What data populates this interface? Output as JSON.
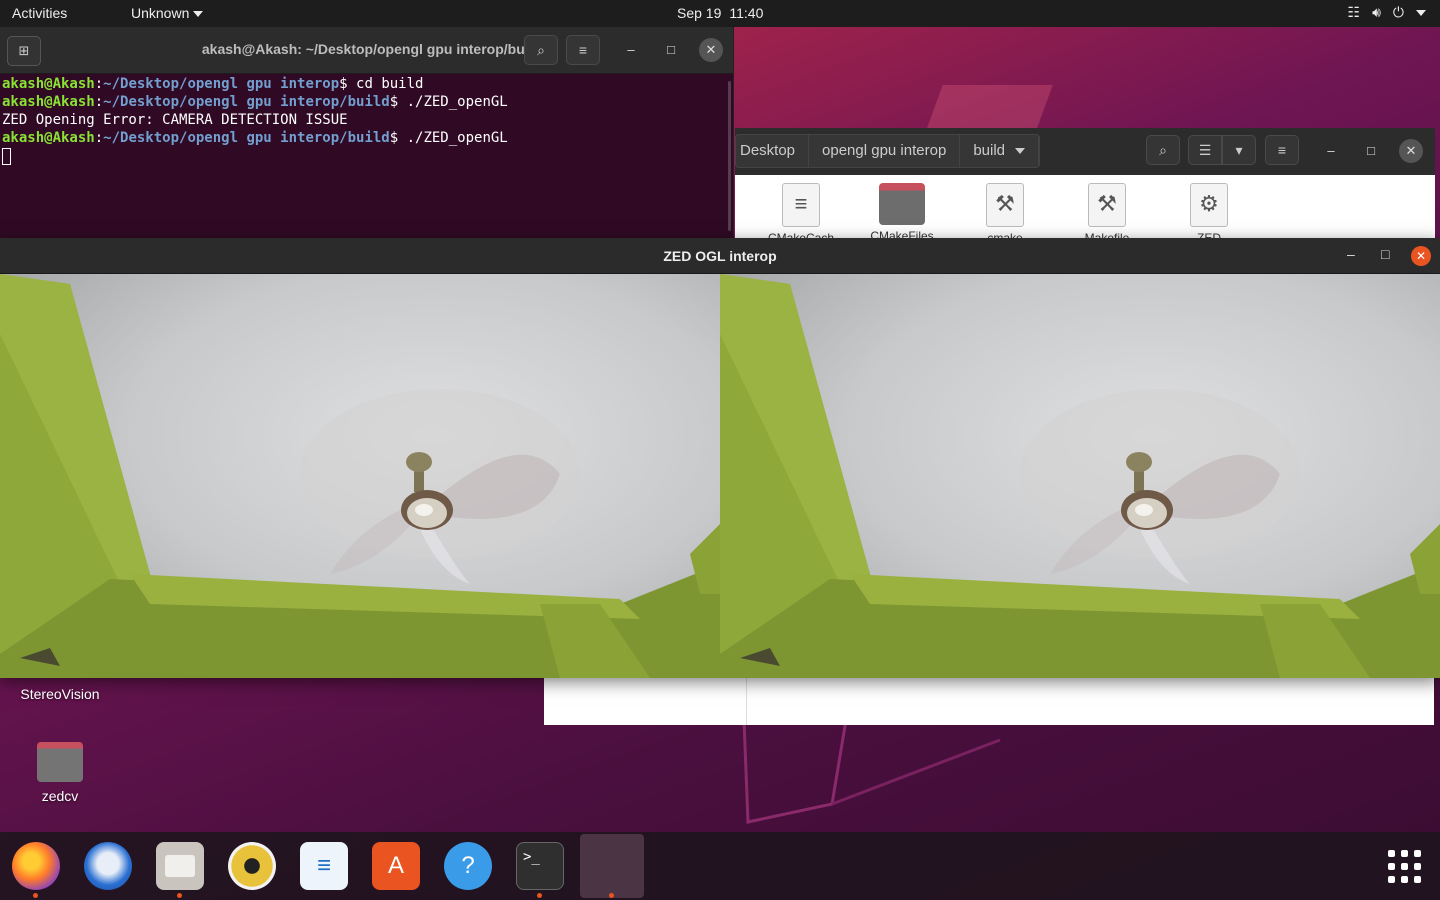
{
  "topbar": {
    "activities": "Activities",
    "app_menu": "Unknown",
    "date": "Sep 19",
    "time": "11:40"
  },
  "terminal": {
    "title": "akash@Akash: ~/Desktop/opengl gpu interop/build",
    "lines": [
      {
        "user": "akash@Akash",
        "path": "~/Desktop/opengl gpu interop",
        "cmd": "$ cd build"
      },
      {
        "user": "akash@Akash",
        "path": "~/Desktop/opengl gpu interop/build",
        "cmd": "$ ./ZED_openGL"
      },
      {
        "text": "ZED Opening Error: CAMERA DETECTION ISSUE"
      },
      {
        "user": "akash@Akash",
        "path": "~/Desktop/opengl gpu interop/build",
        "cmd": "$ ./ZED_openGL"
      }
    ]
  },
  "files": {
    "breadcrumbs": [
      "Desktop",
      "opengl gpu interop",
      "build"
    ],
    "items": [
      "CMakeCach",
      "CMakeFiles",
      "cmake",
      "Makefile",
      "ZED"
    ]
  },
  "zed_window": {
    "title": "ZED OGL interop"
  },
  "desktop_icons": [
    "StereoVision",
    "zedcv"
  ],
  "dock": {
    "apps": [
      "firefox",
      "thunderbird",
      "files",
      "rhythmbox",
      "libreoffice-writer",
      "software",
      "help",
      "terminal",
      "zed-ogl-interop"
    ]
  },
  "colors": {
    "accent": "#e95420",
    "terminal_bg": "#300a24",
    "prompt_user": "#8ae234",
    "prompt_path": "#729fcf"
  }
}
